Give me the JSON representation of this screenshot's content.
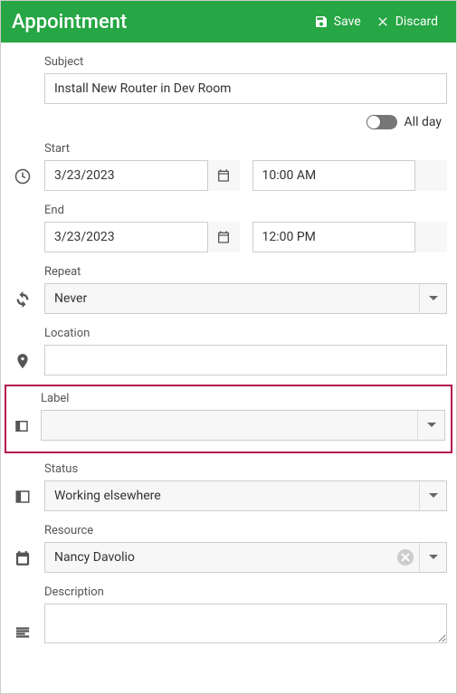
{
  "header": {
    "title": "Appointment",
    "save_label": "Save",
    "discard_label": "Discard"
  },
  "labels": {
    "subject": "Subject",
    "allday": "All day",
    "start": "Start",
    "end": "End",
    "repeat": "Repeat",
    "location": "Location",
    "label_field": "Label",
    "status": "Status",
    "resource": "Resource",
    "description": "Description"
  },
  "values": {
    "subject": "Install New Router in Dev Room",
    "start_date": "3/23/2023",
    "start_time": "10:00 AM",
    "end_date": "3/23/2023",
    "end_time": "12:00 PM",
    "repeat": "Never",
    "location": "",
    "label_field": "",
    "status": "Working elsewhere",
    "resource": "Nancy Davolio",
    "description": ""
  }
}
